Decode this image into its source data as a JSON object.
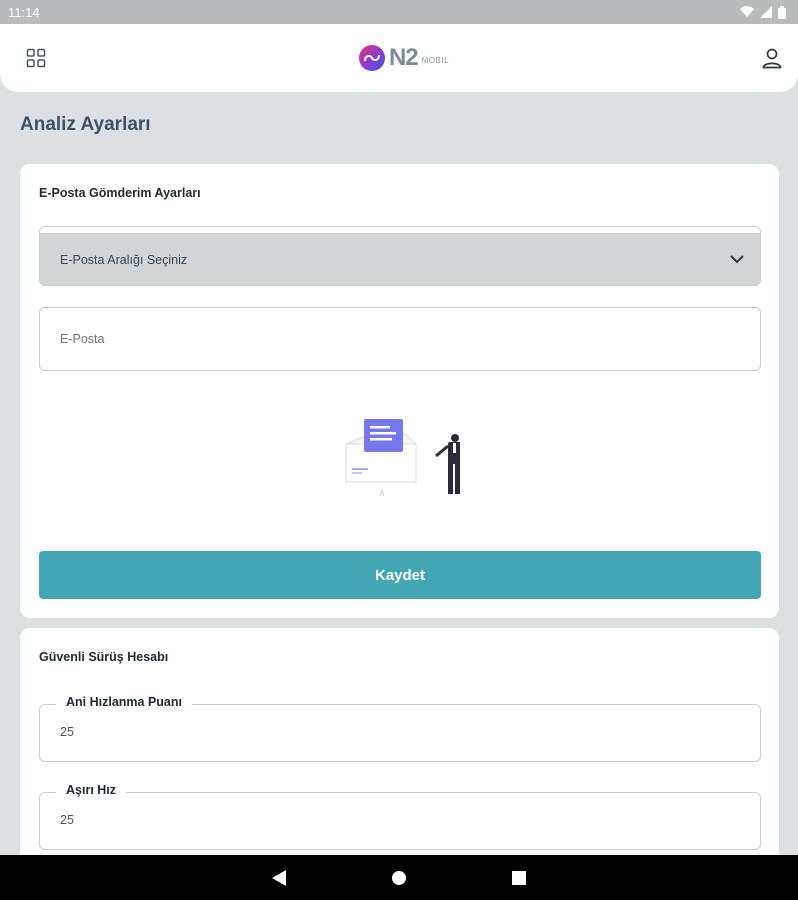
{
  "status_bar": {
    "time": "11:14"
  },
  "header": {
    "logo_text": "N2",
    "logo_sub": "MOBIL"
  },
  "page": {
    "title": "Analiz Ayarları"
  },
  "email_card": {
    "title": "E-Posta Gömderim Ayarları",
    "interval_select": {
      "selected": "E-Posta Aralığı Seçiniz"
    },
    "email_field": {
      "placeholder": "E-Posta"
    },
    "save_label": "Kaydet"
  },
  "safe_driving_card": {
    "title": "Güvenli Sürüş Hesabı",
    "fields": [
      {
        "label": "Ani Hızlanma Puanı",
        "value": "25"
      },
      {
        "label": "Aşırı Hız",
        "value": "25"
      }
    ]
  },
  "colors": {
    "accent": "#43a6b5",
    "page_background": "#dde0e3",
    "title": "#3d5266",
    "select_background": "#d2d5d8"
  },
  "icons": [
    "wifi-icon",
    "signal-icon",
    "battery-icon",
    "apps-grid-icon",
    "user-icon",
    "chevron-down-icon",
    "back-icon",
    "home-icon",
    "recents-icon"
  ]
}
